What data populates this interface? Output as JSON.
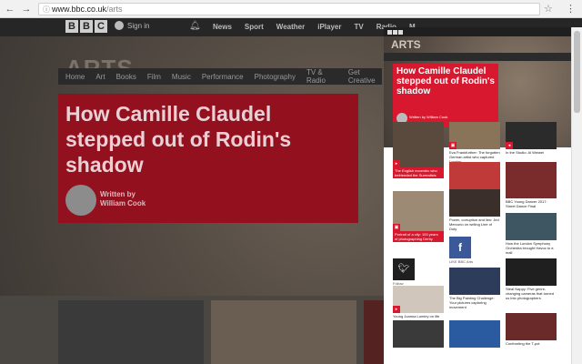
{
  "browser": {
    "url_host": "www.bbc.co.uk",
    "url_path": "/arts"
  },
  "left_page": {
    "logo": [
      "B",
      "B",
      "C"
    ],
    "signin": "Sign in",
    "top_links": [
      "News",
      "Sport",
      "Weather",
      "iPlayer",
      "TV",
      "Radio",
      "M"
    ],
    "section_title": "ARTS",
    "section_nav": [
      "Home",
      "Art",
      "Books",
      "Film",
      "Music",
      "Performance",
      "Photography",
      "TV & Radio",
      "Get Creative"
    ],
    "headline": "How Camille Claudel stepped out of Rodin's shadow",
    "byline_label": "Written by",
    "byline_author": "William Cook"
  },
  "panel": {
    "section_title": "ARTS",
    "headline": "How Camille Claudel stepped out of Rodin's shadow",
    "byline": "Written by William Cook",
    "cards": [
      {
        "caption": "The English eccentric who befriended the Surrealists",
        "style": "red"
      },
      {
        "caption": "Eva Frankfurther: The forgotten German artist who captured London",
        "style": "plain"
      },
      {
        "caption": "In the Studio: Ai Weiwei",
        "style": "plain"
      },
      {
        "caption": "",
        "style": "plain"
      },
      {
        "caption": "Power, corruption and lies: Jed Mercurio on writing Line of Duty",
        "style": "plain"
      },
      {
        "caption": "BBC Young Dancer 2017: Street Dance Final",
        "style": "plain"
      },
      {
        "caption": "Portrait of a city: 100 years of photographing Derby",
        "style": "red"
      },
      {
        "caption": "",
        "style": "plain"
      },
      {
        "caption": "How the London Symphony Orchestra brought Havoc to a mall",
        "style": "plain"
      },
      {
        "caption": "The Big Painting Challenge: Your pictures capturing movement",
        "style": "plain"
      },
      {
        "caption": "Young Joanna Lumley on life as a model",
        "style": "plain"
      },
      {
        "caption": "Steal Nappy: Five genre-changing cameras that turned us into photographers",
        "style": "plain"
      },
      {
        "caption": "Confronting the T-pot",
        "style": "plain"
      }
    ],
    "social": {
      "facebook": "f",
      "facebook_label": "LIKE BBC Arts",
      "twitter_label": "Follow"
    }
  }
}
